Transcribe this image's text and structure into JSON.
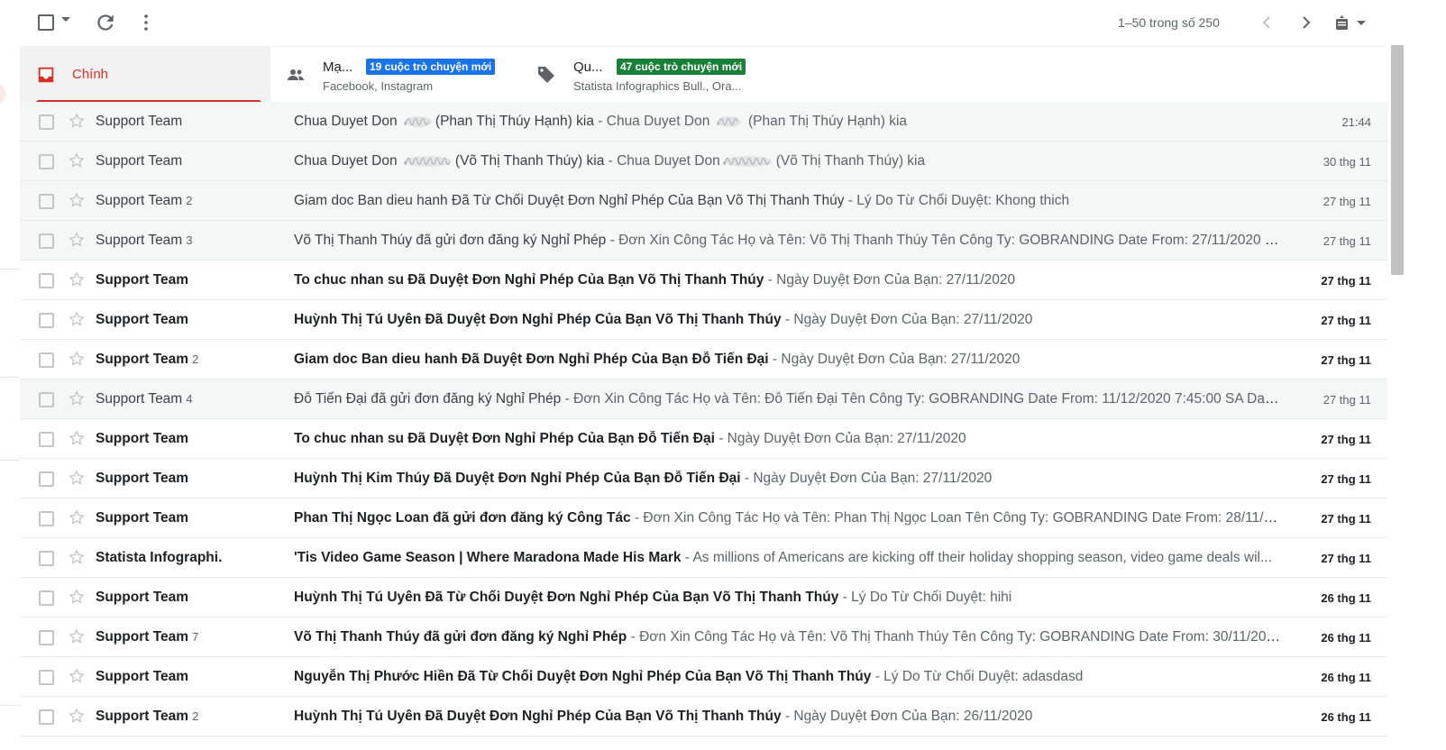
{
  "toolbar": {
    "pager": "1–50 trong số 250",
    "icons": [
      "select-all-checkbox",
      "select-dropdown-caret",
      "refresh-icon",
      "more-vert-icon",
      "chevron-left-icon",
      "chevron-right-icon",
      "keyboard-input-icon"
    ]
  },
  "tabs": [
    {
      "label": "Chính",
      "icon": "inbox-icon",
      "active": true,
      "color": "#d93025"
    },
    {
      "label": "Mạ...",
      "badge": "19 cuộc trò chuyện mới",
      "badge_color": "#1a73e8",
      "sub": "Facebook, Instagram",
      "icon": "people-icon"
    },
    {
      "label": "Qu...",
      "badge": "47 cuộc trò chuyện mới",
      "badge_color": "#188038",
      "sub": "Statista Infographics Bull., Ora...",
      "icon": "tag-icon"
    }
  ],
  "emails": [
    {
      "sender": "Support Team",
      "count": "",
      "subject_parts": [
        "Chua Duyet Don ",
        "(Phan Thị Thúy Hạnh) kia"
      ],
      "snippet_parts": [
        "Chua Duyet Don ",
        " (Phan Thị Thúy Hạnh) kia"
      ],
      "date": "21:44",
      "unread": false
    },
    {
      "sender": "Support Team",
      "count": "",
      "subject_parts": [
        "Chua Duyet Don ",
        "(Võ Thị Thanh Thúy) kia"
      ],
      "snippet_parts": [
        "Chua Duyet Don",
        "(Võ Thị Thanh Thúy) kia"
      ],
      "date": "30 thg 11",
      "unread": false
    },
    {
      "sender": "Support Team",
      "count": "2",
      "subject": "Giam doc Ban dieu hanh Đã Từ Chối Duyệt Đơn Nghỉ Phép Của Bạn Võ Thị Thanh Thúy",
      "snippet": "Lý Do Từ Chối Duyệt: Khong thich",
      "date": "27 thg 11",
      "unread": false
    },
    {
      "sender": "Support Team",
      "count": "3",
      "subject": "Võ Thị Thanh Thúy đã gửi đơn đăng ký Nghỉ Phép",
      "snippet": "Đơn Xin Công Tác Họ và Tên: Võ Thị Thanh Thúy Tên Công Ty: GOBRANDING Date From: 27/11/2020 7:...",
      "date": "27 thg 11",
      "unread": false
    },
    {
      "sender": "Support Team",
      "count": "",
      "subject": "To chuc nhan su Đã Duyệt Đơn Nghỉ Phép Của Bạn Võ Thị Thanh Thúy",
      "snippet": "Ngày Duyệt Đơn Của Bạn: 27/11/2020",
      "date": "27 thg 11",
      "unread": true
    },
    {
      "sender": "Support Team",
      "count": "",
      "subject": "Huỳnh Thị Tú Uyên Đã Duyệt Đơn Nghỉ Phép Của Bạn Võ Thị Thanh Thúy",
      "snippet": "Ngày Duyệt Đơn Của Bạn: 27/11/2020",
      "date": "27 thg 11",
      "unread": true
    },
    {
      "sender": "Support Team",
      "count": "2",
      "subject": "Giam doc Ban dieu hanh Đã Duyệt Đơn Nghỉ Phép Của Bạn Đỗ Tiến Đại",
      "snippet": "Ngày Duyệt Đơn Của Bạn: 27/11/2020",
      "date": "27 thg 11",
      "unread": true
    },
    {
      "sender": "Support Team",
      "count": "4",
      "subject": "Đỗ Tiến Đại đã gửi đơn đăng ký Nghỉ Phép",
      "snippet": "Đơn Xin Công Tác Họ và Tên: Đỗ Tiến Đại Tên Công Ty: GOBRANDING Date From: 11/12/2020 7:45:00 SA Date...",
      "date": "27 thg 11",
      "unread": false
    },
    {
      "sender": "Support Team",
      "count": "",
      "subject": "To chuc nhan su Đã Duyệt Đơn Nghỉ Phép Của Bạn Đỗ Tiến Đại",
      "snippet": "Ngày Duyệt Đơn Của Bạn: 27/11/2020",
      "date": "27 thg 11",
      "unread": true
    },
    {
      "sender": "Support Team",
      "count": "",
      "subject": "Huỳnh Thị Kim Thúy Đã Duyệt Đơn Nghỉ Phép Của Bạn Đỗ Tiến Đại",
      "snippet": "Ngày Duyệt Đơn Của Bạn: 27/11/2020",
      "date": "27 thg 11",
      "unread": true
    },
    {
      "sender": "Support Team",
      "count": "",
      "subject": "Phan Thị Ngọc Loan đã gửi đơn đăng ký Công Tác",
      "snippet": "Đơn Xin Công Tác Họ và Tên: Phan Thị Ngọc Loan Tên Công Ty: GOBRANDING Date From: 28/11/202...",
      "date": "27 thg 11",
      "unread": true
    },
    {
      "sender": "Statista Infographi.",
      "count": "",
      "subject": "'Tis Video Game Season | Where Maradona Made His Mark",
      "snippet": "As millions of Americans are kicking off their holiday shopping season, video game deals wil...",
      "date": "27 thg 11",
      "unread": true
    },
    {
      "sender": "Support Team",
      "count": "",
      "subject": "Huỳnh Thị Tú Uyên Đã Từ Chối Duyệt Đơn Nghỉ Phép Của Bạn Võ Thị Thanh Thúy",
      "snippet": "Lý Do Từ Chối Duyệt: hihi",
      "date": "26 thg 11",
      "unread": true
    },
    {
      "sender": "Support Team",
      "count": "7",
      "subject": "Võ Thị Thanh Thúy đã gửi đơn đăng ký Nghỉ Phép",
      "snippet": "Đơn Xin Công Tác Họ và Tên: Võ Thị Thanh Thúy Tên Công Ty: GOBRANDING Date From: 30/11/2020 ...",
      "date": "26 thg 11",
      "unread": true
    },
    {
      "sender": "Support Team",
      "count": "",
      "subject": "Nguyễn Thị Phước Hiền Đã Từ Chối Duyệt Đơn Nghỉ Phép Của Bạn Võ Thị Thanh Thúy",
      "snippet": "Lý Do Từ Chối Duyệt: adasdasd",
      "date": "26 thg 11",
      "unread": true
    },
    {
      "sender": "Support Team",
      "count": "2",
      "subject": "Huỳnh Thị Tú Uyên Đã Duyệt Đơn Nghỉ Phép Của Bạn Võ Thị Thanh Thúy",
      "snippet": "Ngày Duyệt Đơn Của Bạn: 26/11/2020",
      "date": "26 thg 11",
      "unread": true
    }
  ],
  "separator": " - "
}
